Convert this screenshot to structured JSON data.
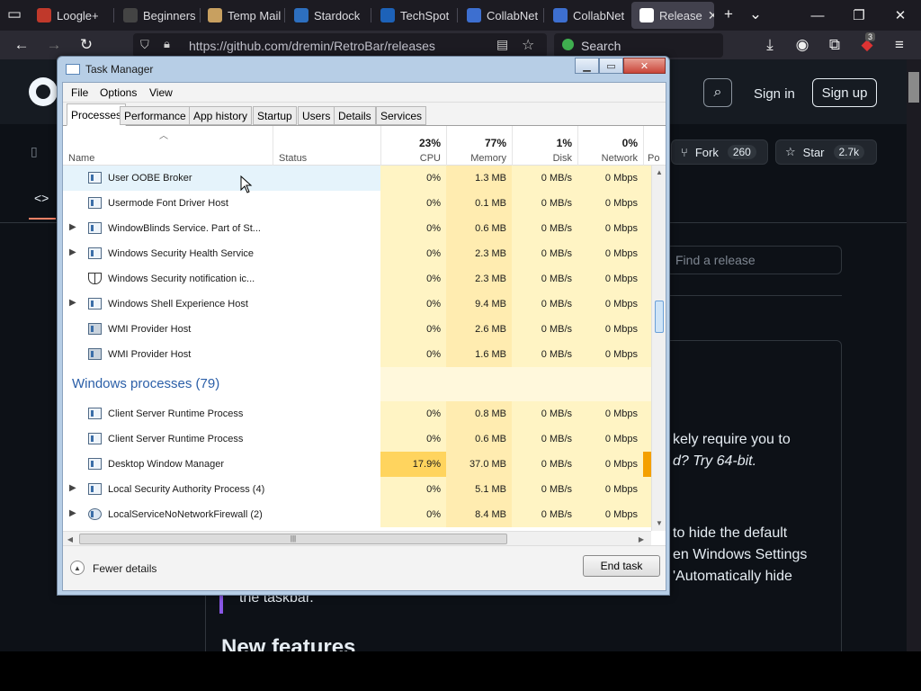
{
  "browser": {
    "tabs": [
      {
        "label": "Loogle+",
        "icon_color": "#c0392b",
        "active": false
      },
      {
        "label": "Beginners",
        "icon_color": "#444444",
        "active": false
      },
      {
        "label": "Temp Mail",
        "icon_color": "#c8a060",
        "active": false
      },
      {
        "label": "Stardock",
        "icon_color": "#2d6fbf",
        "active": false
      },
      {
        "label": "TechSpot",
        "icon_color": "#1d62b8",
        "active": false
      },
      {
        "label": "CollabNet",
        "icon_color": "#3d6fd0",
        "active": false
      },
      {
        "label": "CollabNet",
        "icon_color": "#3d6fd0",
        "active": false
      },
      {
        "label": "Release",
        "icon_color": "#ffffff",
        "active": true
      }
    ],
    "url": "https://github.com/dremin/RetroBar/releases",
    "search_label": "Search",
    "extension_badge": "3"
  },
  "github": {
    "sign_in": "Sign in",
    "sign_up": "Sign up",
    "fork_label": "Fork",
    "fork_count": "260",
    "star_label": "Star",
    "star_count": "2.7k",
    "find_release_placeholder": "Find a release",
    "body_fragments": [
      "kely require you to",
      "d? Try 64-bit.",
      "to hide the default",
      "en Windows Settings",
      "'Automatically hide",
      "the taskbar."
    ],
    "heading": "New features"
  },
  "taskmanager": {
    "title": "Task Manager",
    "menu": [
      "File",
      "Options",
      "View"
    ],
    "tabs": [
      "Processes",
      "Performance",
      "App history",
      "Startup",
      "Users",
      "Details",
      "Services"
    ],
    "active_tab": "Processes",
    "columns": {
      "name": "Name",
      "status": "Status",
      "cpu": {
        "label": "CPU",
        "total": "23%"
      },
      "memory": {
        "label": "Memory",
        "total": "77%"
      },
      "disk": {
        "label": "Disk",
        "total": "1%"
      },
      "network": {
        "label": "Network",
        "total": "0%"
      },
      "power": {
        "label": "Po"
      }
    },
    "rows_top": [
      {
        "name": "User OOBE Broker",
        "expand": false,
        "icon": "app",
        "cpu": "0%",
        "mem": "1.3 MB",
        "disk": "0 MB/s",
        "net": "0 Mbps",
        "hover": true
      },
      {
        "name": "Usermode Font Driver Host",
        "expand": false,
        "icon": "app",
        "cpu": "0%",
        "mem": "0.1 MB",
        "disk": "0 MB/s",
        "net": "0 Mbps"
      },
      {
        "name": "WindowBlinds Service.  Part of St...",
        "expand": true,
        "icon": "app",
        "cpu": "0%",
        "mem": "0.6 MB",
        "disk": "0 MB/s",
        "net": "0 Mbps"
      },
      {
        "name": "Windows Security Health Service",
        "expand": true,
        "icon": "app",
        "cpu": "0%",
        "mem": "2.3 MB",
        "disk": "0 MB/s",
        "net": "0 Mbps"
      },
      {
        "name": "Windows Security notification ic...",
        "expand": false,
        "icon": "shield",
        "cpu": "0%",
        "mem": "2.3 MB",
        "disk": "0 MB/s",
        "net": "0 Mbps"
      },
      {
        "name": "Windows Shell Experience Host",
        "expand": true,
        "icon": "app",
        "cpu": "0%",
        "mem": "9.4 MB",
        "disk": "0 MB/s",
        "net": "0 Mbps"
      },
      {
        "name": "WMI Provider Host",
        "expand": false,
        "icon": "wmi",
        "cpu": "0%",
        "mem": "2.6 MB",
        "disk": "0 MB/s",
        "net": "0 Mbps"
      },
      {
        "name": "WMI Provider Host",
        "expand": false,
        "icon": "wmi",
        "cpu": "0%",
        "mem": "1.6 MB",
        "disk": "0 MB/s",
        "net": "0 Mbps"
      }
    ],
    "group": "Windows processes (79)",
    "rows_bottom": [
      {
        "name": "Client Server Runtime Process",
        "expand": false,
        "icon": "app",
        "cpu": "0%",
        "mem": "0.8 MB",
        "disk": "0 MB/s",
        "net": "0 Mbps"
      },
      {
        "name": "Client Server Runtime Process",
        "expand": false,
        "icon": "app",
        "cpu": "0%",
        "mem": "0.6 MB",
        "disk": "0 MB/s",
        "net": "0 Mbps"
      },
      {
        "name": "Desktop Window Manager",
        "expand": false,
        "icon": "app",
        "cpu": "17.9%",
        "mem": "37.0 MB",
        "disk": "0 MB/s",
        "net": "0 Mbps",
        "hot": true
      },
      {
        "name": "Local Security Authority Process (4)",
        "expand": true,
        "icon": "app",
        "cpu": "0%",
        "mem": "5.1 MB",
        "disk": "0 MB/s",
        "net": "0 Mbps"
      },
      {
        "name": "LocalServiceNoNetworkFirewall (2)",
        "expand": true,
        "icon": "gear",
        "cpu": "0%",
        "mem": "8.4 MB",
        "disk": "0 MB/s",
        "net": "0 Mbps"
      }
    ],
    "fewer_details": "Fewer details",
    "end_task": "End task"
  }
}
